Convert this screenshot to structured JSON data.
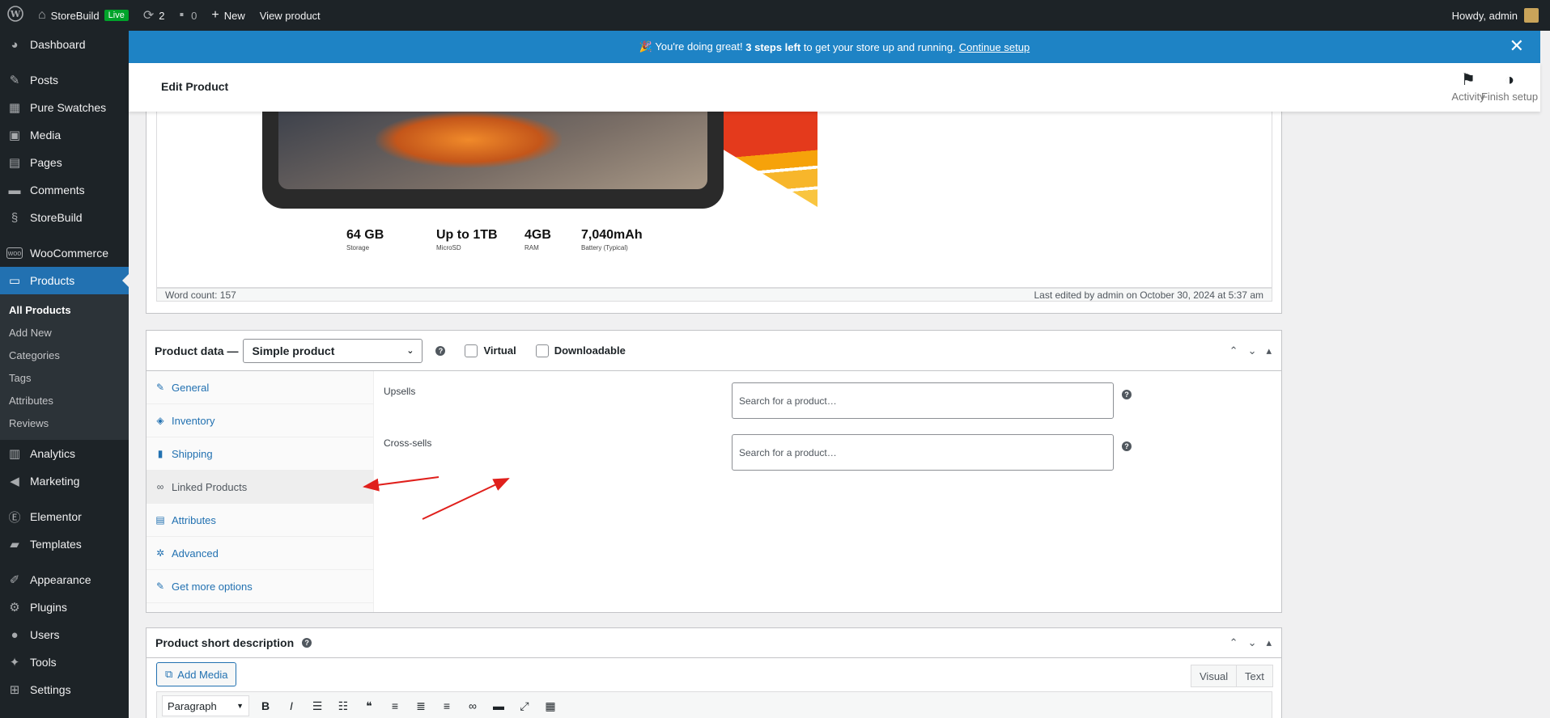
{
  "adminbar": {
    "site_name": "StoreBuild",
    "live_badge": "Live",
    "updates_count": "2",
    "comments_count": "0",
    "new_label": "New",
    "view_product": "View product",
    "howdy": "Howdy, admin"
  },
  "menu": {
    "dashboard": "Dashboard",
    "posts": "Posts",
    "pure_swatches": "Pure Swatches",
    "media": "Media",
    "pages": "Pages",
    "comments": "Comments",
    "storebuild": "StoreBuild",
    "woocommerce": "WooCommerce",
    "products": "Products",
    "products_sub": [
      "All Products",
      "Add New",
      "Categories",
      "Tags",
      "Attributes",
      "Reviews"
    ],
    "analytics": "Analytics",
    "marketing": "Marketing",
    "elementor": "Elementor",
    "templates": "Templates",
    "appearance": "Appearance",
    "plugins": "Plugins",
    "users": "Users",
    "tools": "Tools",
    "settings": "Settings"
  },
  "notice": {
    "prefix": "🎉 You're doing great!",
    "bold": "3 steps left",
    "suffix": "to get your store up and running.",
    "link": "Continue setup"
  },
  "header": {
    "title": "Edit Product",
    "activity": "Activity",
    "finish_setup": "Finish setup"
  },
  "editor": {
    "specs": [
      {
        "value": "64 GB",
        "label": "Storage"
      },
      {
        "value": "Up to 1TB",
        "label": "MicroSD"
      },
      {
        "value": "4GB",
        "label": "RAM"
      },
      {
        "value": "7,040mAh",
        "label": "Battery (Typical)"
      }
    ],
    "word_count": "Word count: 157",
    "last_edited": "Last edited by admin on October 30, 2024 at 5:37 am"
  },
  "product_data": {
    "label": "Product data —",
    "type": "Simple product",
    "virtual": "Virtual",
    "downloadable": "Downloadable",
    "tabs": [
      "General",
      "Inventory",
      "Shipping",
      "Linked Products",
      "Attributes",
      "Advanced",
      "Get more options"
    ],
    "upsells_label": "Upsells",
    "upsells_placeholder": "Search for a product…",
    "crosssells_label": "Cross-sells",
    "crosssells_placeholder": "Search for a product…"
  },
  "short_description": {
    "title": "Product short description",
    "add_media": "Add Media",
    "visual": "Visual",
    "text": "Text",
    "format": "Paragraph"
  },
  "colors": {
    "admin_dark": "#1d2327",
    "accent_blue": "#2271b1",
    "notice_blue": "#1e83c5",
    "arrow_red": "#e0201c"
  }
}
